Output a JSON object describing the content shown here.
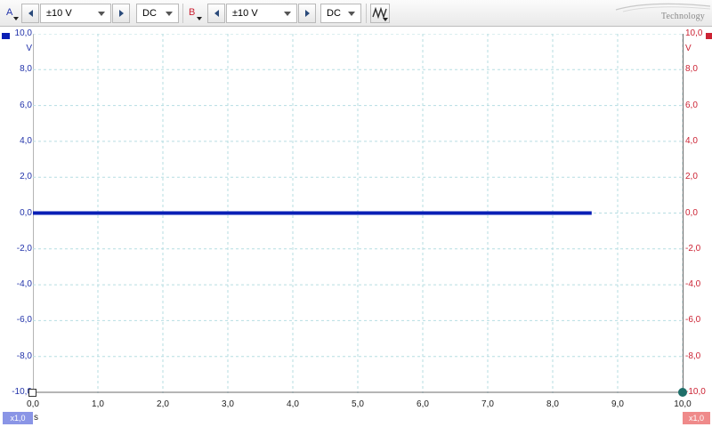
{
  "toolbar": {
    "channel_a": {
      "label": "A",
      "range": "±10 V",
      "coupling": "DC",
      "color": "#2233aa"
    },
    "channel_b": {
      "label": "B",
      "range": "±10 V",
      "coupling": "DC",
      "color": "#cc2233"
    },
    "logo_text": "Technology"
  },
  "axes": {
    "y_unit": "V",
    "y_ticks": [
      "10,0",
      "8,0",
      "6,0",
      "4,0",
      "2,0",
      "0,0",
      "-2,0",
      "-4,0",
      "-6,0",
      "-8,0",
      "-10,0"
    ],
    "y_ticks_right": [
      "10,0",
      "8,0",
      "6,0",
      "4,0",
      "2,0",
      "0,0",
      "-2,0",
      "-4,0",
      "-6,0",
      "-8,0",
      "-10,0"
    ],
    "x_ticks": [
      "0,0",
      "1,0",
      "2,0",
      "3,0",
      "4,0",
      "5,0",
      "6,0",
      "7,0",
      "8,0",
      "9,0",
      "10,0"
    ],
    "x_unit": "s",
    "left_zoom": "x1,0",
    "right_zoom": "x1,0"
  },
  "chart_data": {
    "type": "line",
    "xlim": [
      0,
      10
    ],
    "ylim": [
      -10,
      10
    ],
    "grid": true,
    "series": [
      {
        "color": "#0a1fb5",
        "x": [
          0,
          8.6
        ],
        "y": [
          0,
          0
        ]
      }
    ]
  }
}
